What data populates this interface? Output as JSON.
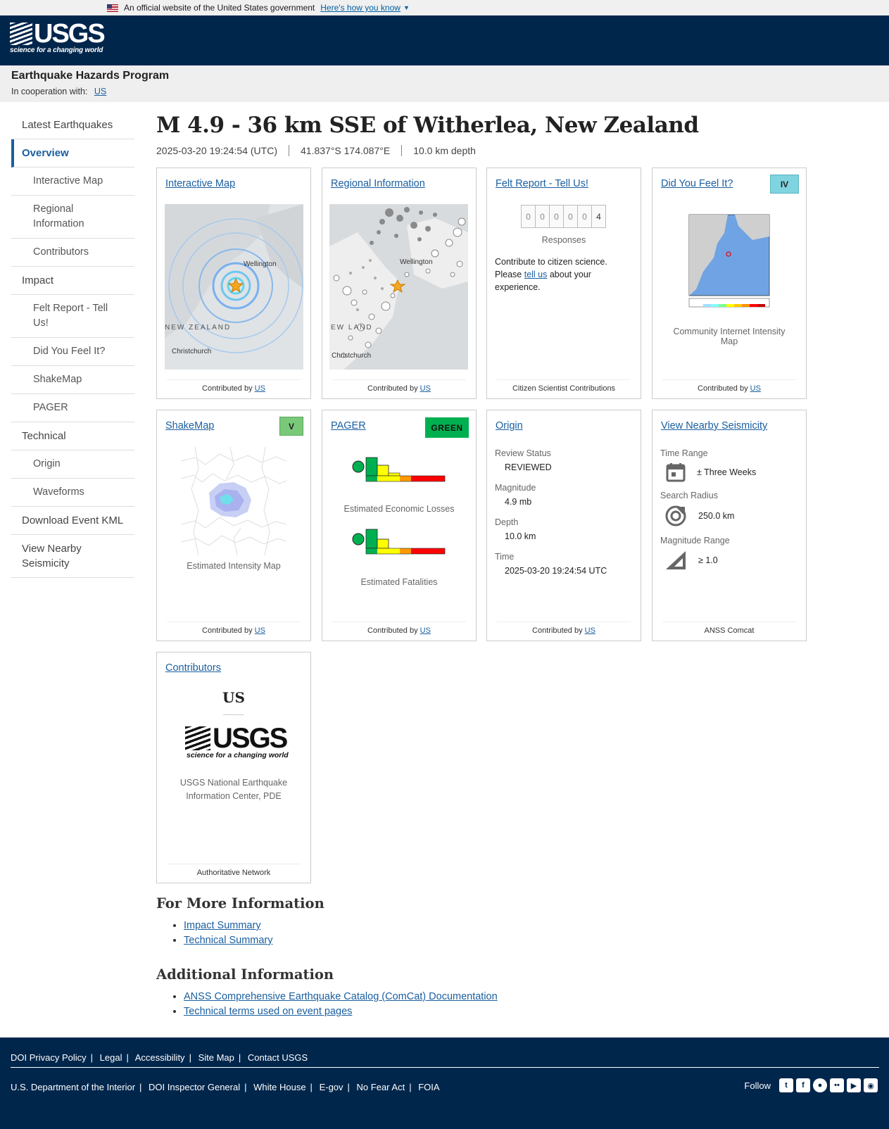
{
  "gov_banner": {
    "text": "An official website of the United States government",
    "link": "Here's how you know"
  },
  "logo": {
    "text": "USGS",
    "tagline": "science for a changing world"
  },
  "program": {
    "title": "Earthquake Hazards Program",
    "coop_label": "In cooperation with:",
    "coop_link": "US"
  },
  "sidebar": {
    "items": [
      {
        "label": "Latest Earthquakes"
      },
      {
        "label": "Overview"
      },
      {
        "label": "Interactive Map"
      },
      {
        "label": "Regional Information"
      },
      {
        "label": "Contributors"
      },
      {
        "label": "Impact"
      },
      {
        "label": "Felt Report - Tell Us!"
      },
      {
        "label": "Did You Feel It?"
      },
      {
        "label": "ShakeMap"
      },
      {
        "label": "PAGER"
      },
      {
        "label": "Technical"
      },
      {
        "label": "Origin"
      },
      {
        "label": "Waveforms"
      },
      {
        "label": "Download Event KML"
      },
      {
        "label": "View Nearby Seismicity"
      }
    ]
  },
  "event": {
    "title": "M 4.9 - 36 km SSE of Witherlea, New Zealand",
    "time": "2025-03-20 19:24:54 (UTC)",
    "location": "41.837°S 174.087°E",
    "depth": "10.0 km depth"
  },
  "cards": {
    "interactive_map": {
      "title": "Interactive Map",
      "footer_prefix": "Contributed by",
      "footer_link": "US",
      "labels": [
        "Wellington",
        "NEW ZEALAND",
        "Christchurch"
      ]
    },
    "regional": {
      "title": "Regional Information",
      "footer_prefix": "Contributed by",
      "footer_link": "US",
      "labels": [
        "Wellington",
        "EW LAND",
        "Christchurch"
      ]
    },
    "felt": {
      "title": "Felt Report - Tell Us!",
      "digits": [
        "0",
        "0",
        "0",
        "0",
        "0",
        "4"
      ],
      "responses": "Responses",
      "text_before": "Contribute to citizen science. Please",
      "link": "tell us",
      "text_after": "about your experience.",
      "footer": "Citizen Scientist Contributions"
    },
    "dyfi": {
      "title": "Did You Feel It?",
      "badge": "IV",
      "badge_color": "#7fd4e0",
      "caption": "Community Internet Intensity Map",
      "footer_prefix": "Contributed by",
      "footer_link": "US"
    },
    "shakemap": {
      "title": "ShakeMap",
      "badge": "V",
      "badge_color": "#7ac87a",
      "caption": "Estimated Intensity Map",
      "footer_prefix": "Contributed by",
      "footer_link": "US"
    },
    "pager": {
      "title": "PAGER",
      "badge": "GREEN",
      "badge_color": "#00b050",
      "caption_losses": "Estimated Economic Losses",
      "caption_fatalities": "Estimated Fatalities",
      "footer_prefix": "Contributed by",
      "footer_link": "US"
    },
    "origin": {
      "title": "Origin",
      "fields": [
        {
          "label": "Review Status",
          "value": "REVIEWED"
        },
        {
          "label": "Magnitude",
          "value": "4.9 mb"
        },
        {
          "label": "Depth",
          "value": "10.0 km"
        },
        {
          "label": "Time",
          "value": "2025-03-20 19:24:54 UTC"
        }
      ],
      "footer_prefix": "Contributed by",
      "footer_link": "US"
    },
    "nearby": {
      "title": "View Nearby Seismicity",
      "time_label": "Time Range",
      "time_value": "± Three Weeks",
      "radius_label": "Search Radius",
      "radius_value": "250.0 km",
      "mag_label": "Magnitude Range",
      "mag_value": "≥ 1.0",
      "footer": "ANSS Comcat"
    },
    "contributors": {
      "title": "Contributors",
      "network": "US",
      "org": "USGS National Earthquake Information Center, PDE",
      "footer": "Authoritative Network"
    }
  },
  "more_info": {
    "title": "For More Information",
    "links": [
      "Impact Summary",
      "Technical Summary"
    ]
  },
  "additional": {
    "title": "Additional Information",
    "links": [
      "ANSS Comprehensive Earthquake Catalog (ComCat) Documentation",
      "Technical terms used on event pages"
    ]
  },
  "footer": {
    "row1": [
      "DOI Privacy Policy",
      "Legal",
      "Accessibility",
      "Site Map",
      "Contact USGS"
    ],
    "row2": [
      "U.S. Department of the Interior",
      "DOI Inspector General",
      "White House",
      "E-gov",
      "No Fear Act",
      "FOIA"
    ],
    "follow": "Follow",
    "social_icons": [
      "twitter-icon",
      "facebook-icon",
      "github-icon",
      "flickr-icon",
      "youtube-icon",
      "instagram-icon"
    ]
  }
}
